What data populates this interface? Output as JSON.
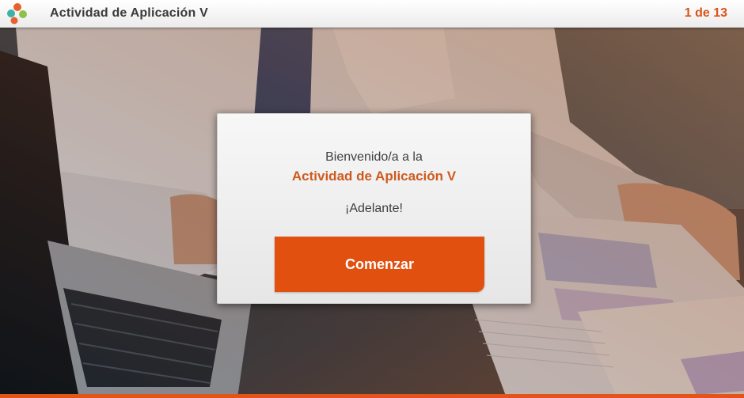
{
  "header": {
    "title": "Actividad de Aplicación V",
    "page_counter": "1 de 13"
  },
  "card": {
    "welcome_text": "Bienvenido/a a la",
    "activity_title": "Actividad de Aplicación V",
    "cheer_text": "¡Adelante!",
    "start_button_label": "Comenzar"
  },
  "colors": {
    "accent": "#e2500f",
    "title_orange": "#cf5a1e",
    "logo_orange": "#e8602c",
    "logo_teal": "#3fb1a6",
    "logo_green": "#8cc24a"
  },
  "icons": {
    "logo": "company-logo-icon"
  }
}
